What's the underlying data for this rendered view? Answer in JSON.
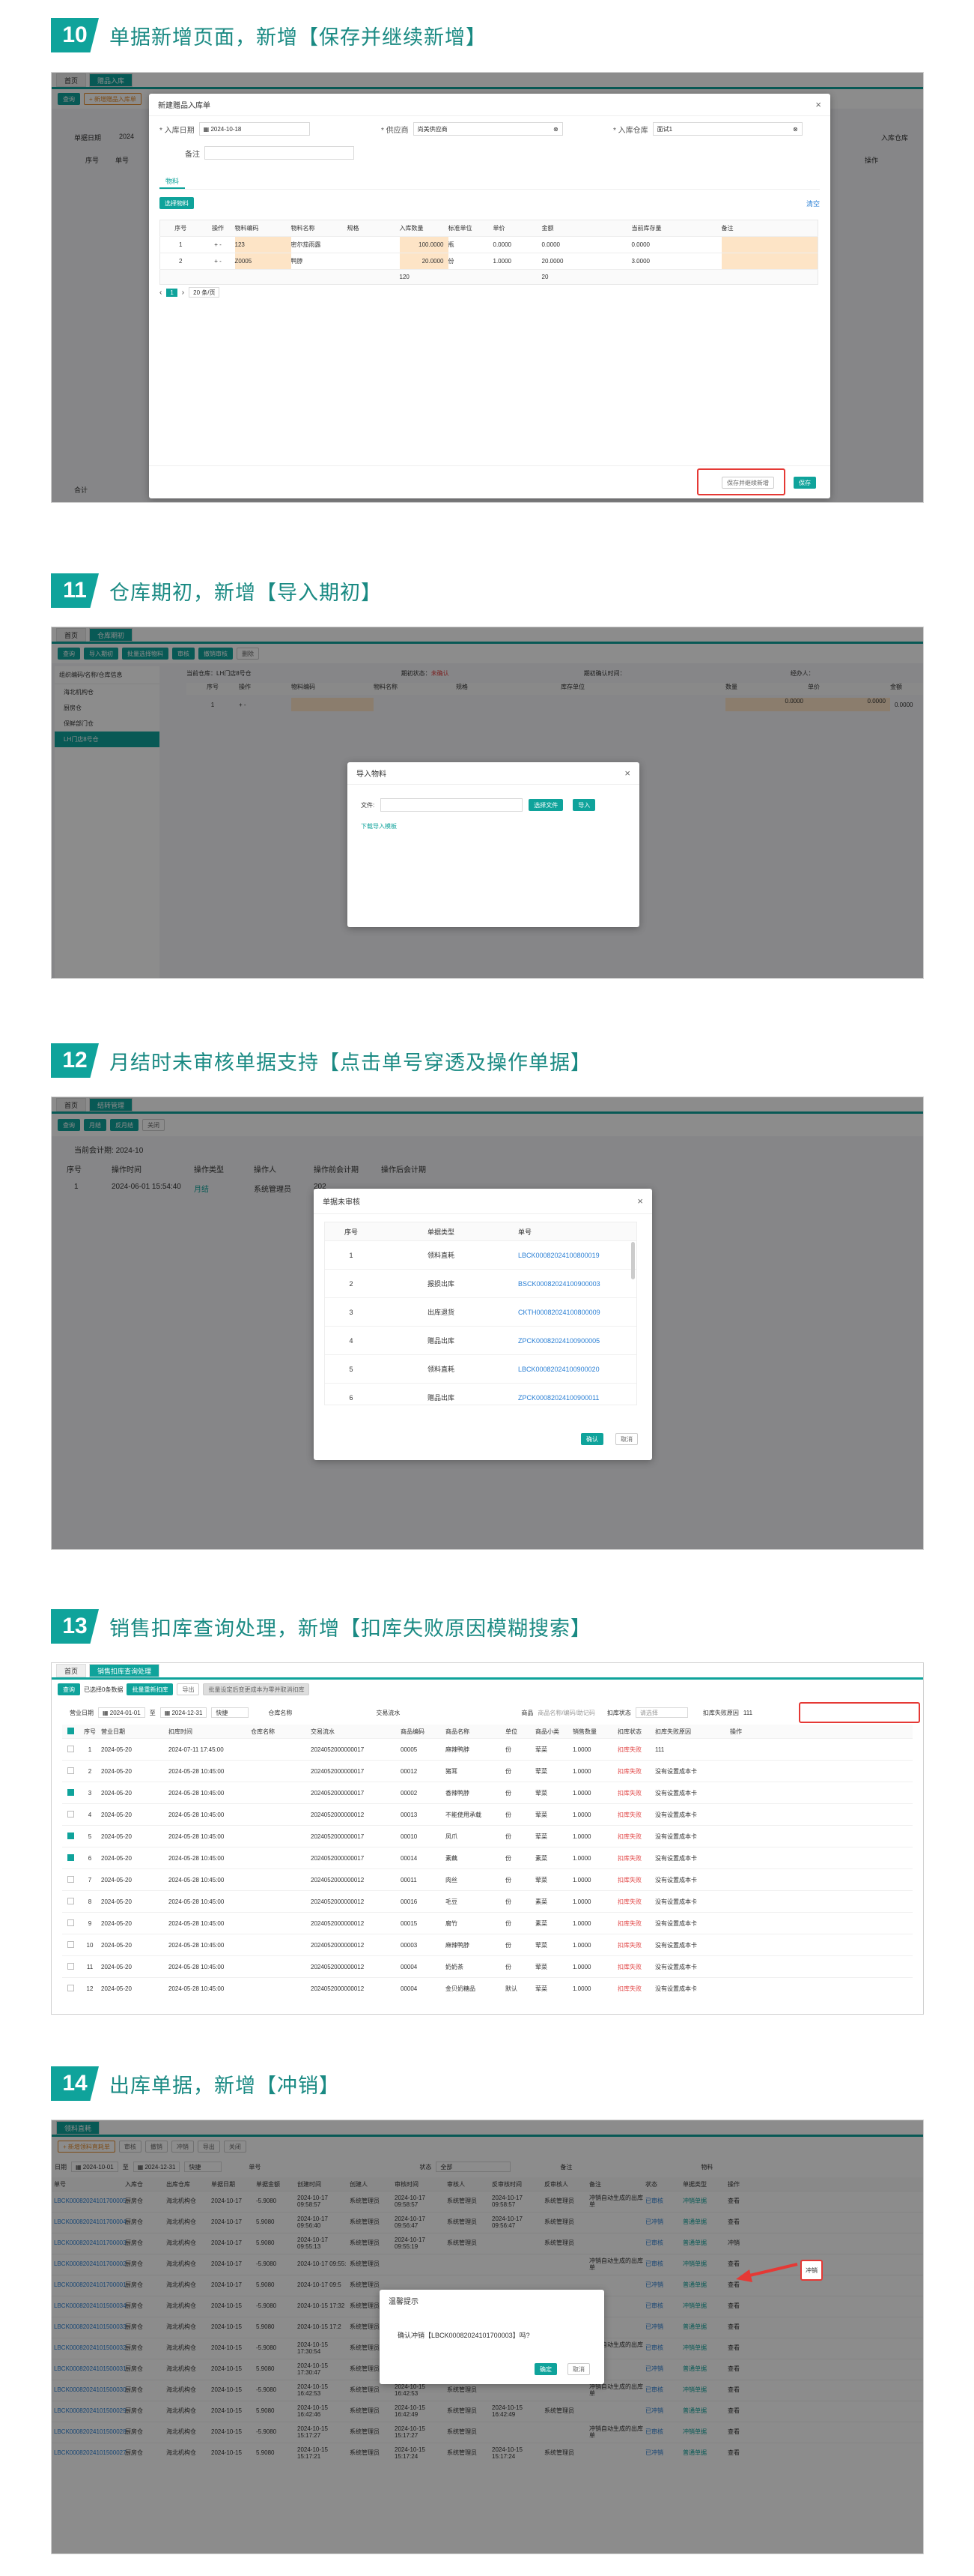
{
  "sections": [
    {
      "num": "10",
      "title": "单据新增页面，新增【保存并继续新增】"
    },
    {
      "num": "11",
      "title": "仓库期初，新增【导入期初】"
    },
    {
      "num": "12",
      "title": "月结时未审核单据支持【点击单号穿透及操作单据】"
    },
    {
      "num": "13",
      "title": "销售扣库查询处理，新增【扣库失败原因模糊搜索】"
    },
    {
      "num": "14",
      "title": "出库单据，新增【冲销】"
    }
  ],
  "s10": {
    "tabs": [
      "首页",
      "赠品入库"
    ],
    "toolbar": [
      "查询",
      "+ 新增赠品入库单"
    ],
    "bg_label": "单据日期",
    "bg_date": "2024",
    "bg_col1": "序号",
    "bg_col2": "单号",
    "bg_right": "入库仓库",
    "bg_ops": "操作",
    "bg_total": "合计",
    "modal_title": "新建赠品入库单",
    "f_date_label": "* 入库日期",
    "f_date_value": "2024-10-18",
    "f_supplier_label": "* 供应商",
    "f_supplier_value": "尚美供应商",
    "f_wh_label": "* 入库仓库",
    "f_wh_value": "面试1",
    "f_remark_label": "备注",
    "subtab": "物料",
    "select_btn": "选择物料",
    "clear_link": "清空",
    "headers": [
      "序号",
      "操作",
      "物料编码",
      "物料名称",
      "规格",
      "入库数量",
      "标准单位",
      "单价",
      "金额",
      "当前库存量",
      "备注"
    ],
    "rows": [
      [
        "1",
        "+ -",
        "123",
        "密尔茄雨露",
        "",
        "100.0000",
        "瓶",
        "0.0000",
        "0.0000",
        "0.0000",
        ""
      ],
      [
        "2",
        "+ -",
        "Z0005",
        "鸭脖",
        "",
        "20.0000",
        "份",
        "1.0000",
        "20.0000",
        "3.0000",
        ""
      ]
    ],
    "sum_qty": "120",
    "sum_amt": "20",
    "page_num": "1",
    "page_size": "20 条/页",
    "btn_save_continue": "保存并继续新增",
    "btn_save": "保存"
  },
  "s11": {
    "tabs": [
      "首页",
      "仓库期初"
    ],
    "toolbar": [
      "查询",
      "导入期初",
      "批量选择物料",
      "审核",
      "撤销审核",
      "删除"
    ],
    "tree_title": "组织编码/名称/仓库信息",
    "tree_items": [
      "海北机构仓",
      "厨房仓",
      "保鲜部门仓",
      "LH门店8号仓"
    ],
    "info_wh_label": "当前仓库：",
    "info_wh_value": "LH门店8号仓",
    "info_status_label": "期初状态：",
    "info_status_value": "未确认",
    "info_time_label": "期初确认时间：",
    "info_person_label": "经办人：",
    "headers": [
      "序号",
      "操作",
      "物料编码",
      "物料名称",
      "规格",
      "库存单位",
      "数量",
      "单价",
      "金额"
    ],
    "row": [
      "1",
      "+ -",
      "",
      "",
      "",
      "",
      "0.0000",
      "0.0000",
      "0.0000"
    ],
    "modal_title": "导入物料",
    "file_label": "文件:",
    "choose_btn": "选择文件",
    "import_btn": "导入",
    "download_link": "下载导入模板"
  },
  "s12": {
    "tabs": [
      "首页",
      "结转管理"
    ],
    "toolbar": [
      "查询",
      "月结",
      "反月结",
      "关闭"
    ],
    "period_label": "当前会计期:",
    "period_value": "2024-10",
    "headers": [
      "序号",
      "操作时间",
      "操作类型",
      "操作人",
      "操作前会计期",
      "操作后会计期"
    ],
    "row": [
      "1",
      "2024-06-01 15:54:40",
      "月结",
      "系统管理员",
      "202"
    ],
    "modal_title": "单据未审核",
    "m_headers": [
      "序号",
      "单据类型",
      "单号"
    ],
    "m_rows": [
      [
        "1",
        "领料直耗",
        "LBCK00082024100800019"
      ],
      [
        "2",
        "报损出库",
        "BSCK00082024100900003"
      ],
      [
        "3",
        "出库退货",
        "CKTH00082024100800009"
      ],
      [
        "4",
        "赠品出库",
        "ZPCK00082024100900005"
      ],
      [
        "5",
        "领料直耗",
        "LBCK00082024100900020"
      ],
      [
        "6",
        "赠品出库",
        "ZPCK00082024100900011"
      ]
    ],
    "confirm_btn": "确认",
    "cancel_btn": "取消"
  },
  "s13": {
    "tabs": [
      "首页",
      "销售扣库查询处理"
    ],
    "toolbar": [
      "查询",
      "已选择0条数据",
      "批量重新扣库",
      "导出",
      "批量设定后变更成本为零并取消扣库"
    ],
    "f_date_label": "营业日期",
    "f_date_from": "2024-01-01",
    "f_date_to": "2024-12-31",
    "f_date_shortcut": "快捷",
    "f_wh_label": "仓库名称",
    "f_flow_label": "交易流水",
    "f_item_label": "商品",
    "f_item_placeholder": "商品名称/编码/助记码",
    "f_status_label": "扣库状态",
    "f_status_value": "请选择",
    "f_reason_label": "扣库失败原因",
    "f_reason_value": "111",
    "headers": [
      "",
      "序号",
      "营业日期",
      "扣库时间",
      "仓库名称",
      "交易流水",
      "商品编码",
      "商品名称",
      "单位",
      "商品小类",
      "销售数量",
      "扣库状态",
      "扣库失败原因",
      "操作"
    ],
    "rows": [
      [
        false,
        "1",
        "2024-05-20",
        "2024-07-11 17:45:00",
        "",
        "2024052000000017",
        "00005",
        "麻辣鸭脖",
        "份",
        "荤菜",
        "1.0000",
        "扣库失败",
        "111"
      ],
      [
        false,
        "2",
        "2024-05-20",
        "2024-05-28 10:45:00",
        "",
        "2024052000000017",
        "00012",
        "猪耳",
        "份",
        "荤菜",
        "1.0000",
        "扣库失败",
        "没有设置成本卡"
      ],
      [
        true,
        "3",
        "2024-05-20",
        "2024-05-28 10:45:00",
        "",
        "2024052000000017",
        "00002",
        "香辣鸭脖",
        "份",
        "荤菜",
        "1.0000",
        "扣库失败",
        "没有设置成本卡"
      ],
      [
        false,
        "4",
        "2024-05-20",
        "2024-05-28 10:45:00",
        "",
        "2024052000000012",
        "00013",
        "不能使用承载",
        "份",
        "荤菜",
        "1.0000",
        "扣库失败",
        "没有设置成本卡"
      ],
      [
        true,
        "5",
        "2024-05-20",
        "2024-05-28 10:45:00",
        "",
        "2024052000000017",
        "00010",
        "凤爪",
        "份",
        "荤菜",
        "1.0000",
        "扣库失败",
        "没有设置成本卡"
      ],
      [
        true,
        "6",
        "2024-05-20",
        "2024-05-28 10:45:00",
        "",
        "2024052000000017",
        "00014",
        "素藕",
        "份",
        "素菜",
        "1.0000",
        "扣库失败",
        "没有设置成本卡"
      ],
      [
        false,
        "7",
        "2024-05-20",
        "2024-05-28 10:45:00",
        "",
        "2024052000000012",
        "00011",
        "肉丝",
        "份",
        "荤菜",
        "1.0000",
        "扣库失败",
        "没有设置成本卡"
      ],
      [
        false,
        "8",
        "2024-05-20",
        "2024-05-28 10:45:00",
        "",
        "2024052000000012",
        "00016",
        "毛豆",
        "份",
        "素菜",
        "1.0000",
        "扣库失败",
        "没有设置成本卡"
      ],
      [
        false,
        "9",
        "2024-05-20",
        "2024-05-28 10:45:00",
        "",
        "2024052000000012",
        "00015",
        "腐竹",
        "份",
        "素菜",
        "1.0000",
        "扣库失败",
        "没有设置成本卡"
      ],
      [
        false,
        "10",
        "2024-05-20",
        "2024-05-28 10:45:00",
        "",
        "2024052000000012",
        "00003",
        "麻辣鸭脖",
        "份",
        "荤菜",
        "1.0000",
        "扣库失败",
        "没有设置成本卡"
      ],
      [
        false,
        "11",
        "2024-05-20",
        "2024-05-28 10:45:00",
        "",
        "2024052000000012",
        "00004",
        "奶奶茶",
        "份",
        "荤菜",
        "1.0000",
        "扣库失败",
        "没有设置成本卡"
      ],
      [
        false,
        "12",
        "2024-05-20",
        "2024-05-28 10:45:00",
        "",
        "2024052000000012",
        "00004",
        "金贝奶糖品",
        "默认",
        "荤菜",
        "1.0000",
        "扣库失败",
        "没有设置成本卡"
      ]
    ]
  },
  "s14": {
    "tabs": [
      "领料直耗"
    ],
    "toolbar": [
      "+ 新增领料直耗单",
      "审核",
      "撤销",
      "冲销",
      "导出",
      "关闭"
    ],
    "f_date_label": "日期",
    "f_date_from": "2024-10-01",
    "f_date_to": "2024-12-31",
    "f_shortcut": "快捷",
    "f_no_label": "单号",
    "f_status_label": "状态",
    "f_status_value": "全部",
    "f_remark_label": "备注",
    "f_item_label": "物料",
    "headers": [
      "单号",
      "入库仓",
      "出库仓库",
      "单据日期",
      "单据金额",
      "创建时间",
      "创建人",
      "审核时间",
      "审核人",
      "反审核时间",
      "反审核人",
      "备注",
      "状态",
      "单据类型",
      "操作"
    ],
    "rows": [
      [
        "LBCK00082024101700005",
        "厨房仓",
        "海北机构仓",
        "2024-10-17",
        "-5.9080",
        "2024-10-17 09:58:57",
        "系统管理员",
        "2024-10-17 09:58:57",
        "系统管理员",
        "2024-10-17 09:58:57",
        "系统管理员",
        "冲销自动生成的出库单",
        "已审核",
        "冲销单据",
        "查看"
      ],
      [
        "LBCK00082024101700004",
        "厨房仓",
        "海北机构仓",
        "2024-10-17",
        "5.9080",
        "2024-10-17 09:56:40",
        "系统管理员",
        "2024-10-17 09:56:47",
        "系统管理员",
        "2024-10-17 09:56:47",
        "系统管理员",
        "",
        "已冲销",
        "普通单据",
        "查看"
      ],
      [
        "LBCK00082024101700003",
        "厨房仓",
        "海北机构仓",
        "2024-10-17",
        "5.9080",
        "2024-10-17 09:55:13",
        "系统管理员",
        "2024-10-17 09:55:19",
        "系统管理员",
        "",
        "系统管理员",
        "",
        "已审核",
        "普通单据",
        "冲销"
      ],
      [
        "LBCK00082024101700002",
        "厨房仓",
        "海北机构仓",
        "2024-10-17",
        "-5.9080",
        "2024-10-17 09:55:",
        "系统管理员",
        "",
        "",
        "",
        "",
        "冲销自动生成的出库单",
        "已审核",
        "冲销单据",
        "查看"
      ],
      [
        "LBCK00082024101700001",
        "厨房仓",
        "海北机构仓",
        "2024-10-17",
        "5.9080",
        "2024-10-17 09:5",
        "系统管理员",
        "",
        "",
        "",
        "",
        "",
        "已冲销",
        "普通单据",
        "查看"
      ],
      [
        "LBCK00082024101500034",
        "厨房仓",
        "海北机构仓",
        "2024-10-15",
        "-5.9080",
        "2024-10-15 17:32",
        "系统管理员",
        "",
        "",
        "",
        "",
        "",
        "已审核",
        "冲销单据",
        "查看"
      ],
      [
        "LBCK00082024101500033",
        "厨房仓",
        "海北机构仓",
        "2024-10-15",
        "5.9080",
        "2024-10-15 17:2",
        "系统管理员",
        "",
        "",
        "",
        "",
        "",
        "已冲销",
        "普通单据",
        "查看"
      ],
      [
        "LBCK00082024101500032",
        "厨房仓",
        "海北机构仓",
        "2024-10-15",
        "-5.9080",
        "2024-10-15 17:30:54",
        "系统管理员",
        "2024-10-15 17:30:54",
        "系统管理员",
        "",
        "",
        "冲销自动生成的出库单",
        "已审核",
        "冲销单据",
        "查看"
      ],
      [
        "LBCK00082024101500031",
        "厨房仓",
        "海北机构仓",
        "2024-10-15",
        "5.9080",
        "2024-10-15 17:30:47",
        "系统管理员",
        "2024-10-15 17:30:49",
        "系统管理员",
        "2024-10-15 17:30:49",
        "系统管理员",
        "",
        "已冲销",
        "普通单据",
        "查看"
      ],
      [
        "LBCK00082024101500030",
        "厨房仓",
        "海北机构仓",
        "2024-10-15",
        "-5.9080",
        "2024-10-15 16:42:53",
        "系统管理员",
        "2024-10-15 16:42:53",
        "系统管理员",
        "",
        "",
        "冲销自动生成的出库单",
        "已审核",
        "冲销单据",
        "查看"
      ],
      [
        "LBCK00082024101500029",
        "厨房仓",
        "海北机构仓",
        "2024-10-15",
        "5.9080",
        "2024-10-15 16:42:46",
        "系统管理员",
        "2024-10-15 16:42:49",
        "系统管理员",
        "2024-10-15 16:42:49",
        "系统管理员",
        "",
        "已冲销",
        "普通单据",
        "查看"
      ],
      [
        "LBCK00082024101500028",
        "厨房仓",
        "海北机构仓",
        "2024-10-15",
        "-5.9080",
        "2024-10-15 15:17:27",
        "系统管理员",
        "2024-10-15 15:17:27",
        "系统管理员",
        "",
        "",
        "冲销自动生成的出库单",
        "已审核",
        "冲销单据",
        "查看"
      ],
      [
        "LBCK00082024101500027",
        "厨房仓",
        "海北机构仓",
        "2024-10-15",
        "5.9080",
        "2024-10-15 15:17:21",
        "系统管理员",
        "2024-10-15 15:17:24",
        "系统管理员",
        "2024-10-15 15:17:24",
        "系统管理员",
        "",
        "已冲销",
        "普通单据",
        "查看"
      ]
    ],
    "modal_title": "温馨提示",
    "modal_msg": "确认冲销【LBCK00082024101700003】吗?",
    "confirm_btn": "确定",
    "cancel_btn": "取消"
  },
  "colors": {
    "accent": "#0fa39b",
    "link": "#2a7fd4",
    "alert": "#e53935",
    "highlight": "#fde4c6"
  }
}
